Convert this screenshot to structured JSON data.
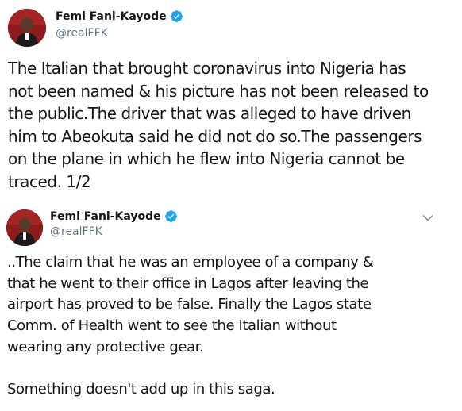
{
  "tweets": [
    {
      "author": {
        "display_name": "Femi Fani-Kayode",
        "handle": "@realFFK",
        "verified": true
      },
      "lines": [
        "The Italian that brought coronavirus into Nigeria has",
        "not been named & his picture has not been released to",
        "the public.The driver that was alleged to have driven",
        "him to Abeokuta said he did not do so.The passengers",
        "on the plane in which he flew into Nigeria cannot be",
        "traced. 1/2"
      ]
    },
    {
      "author": {
        "display_name": "Femi Fani-Kayode",
        "handle": "@realFFK",
        "verified": true
      },
      "paragraphs": [
        [
          "..The claim that he was an employee of a company &",
          "that he went to their office in Lagos after leaving the",
          "airport has proved to be false. Finally the Lagos state",
          "Comm. of Health went to see the Italian without",
          "wearing any protective gear."
        ],
        [
          "Something doesn't add up in this saga."
        ]
      ]
    }
  ],
  "colors": {
    "text": "#14171a",
    "secondary_text": "#657786",
    "verified_blue": "#1da1f2",
    "background": "#ffffff"
  },
  "icons": {
    "verified": "verified-badge-icon",
    "more": "chevron-down-icon"
  }
}
